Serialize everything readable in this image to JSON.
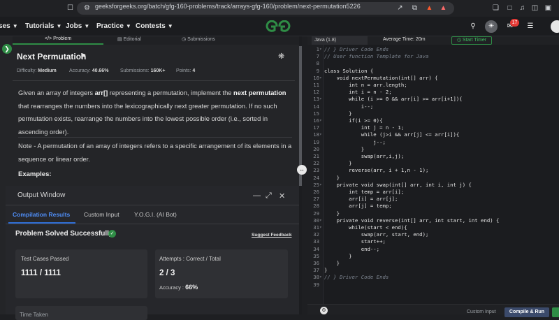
{
  "browser": {
    "url": "geeksforgeeks.org/batch/gfg-160-problems/track/arrays-gfg-160/problem/next-permutation5226",
    "notification_count": "17"
  },
  "nav": {
    "items": [
      {
        "label": "ses"
      },
      {
        "label": "Tutorials"
      },
      {
        "label": "Jobs"
      },
      {
        "label": "Practice"
      },
      {
        "label": "Contests"
      }
    ]
  },
  "left_tabs": {
    "problem": "Problem",
    "editorial": "Editorial",
    "submissions": "Submissions"
  },
  "problem": {
    "title": "Next Permutation",
    "meta": [
      {
        "label": "Difficulty:",
        "value": "Medium"
      },
      {
        "label": "Accuracy:",
        "value": "40.66%"
      },
      {
        "label": "Submissions:",
        "value": "160K+"
      },
      {
        "label": "Points:",
        "value": "4"
      }
    ],
    "para1": {
      "t1": "Given an array of integers ",
      "b1": "arr[]",
      "t2": " representing a permutation, implement the ",
      "b2": "next permutation",
      "t3": " that rearranges the numbers into the lexicographically next greater permutation. If no such permutation exists, rearrange the numbers into the lowest possible order (i.e., sorted in ascending order)."
    },
    "para2": "Note - A permutation of an array of integers refers to a specific arrangement of its elements in a sequence or linear order.",
    "examples_label": "Examples:"
  },
  "output": {
    "title": "Output Window",
    "tabs": [
      "Compilation Results",
      "Custom Input",
      "Y.O.G.I. (AI Bot)"
    ],
    "status": "Problem Solved Successfully",
    "feedback": "Suggest Feedback",
    "test_cases_label": "Test Cases Passed",
    "test_cases_value": "1111 / 1111",
    "attempts_label": "Attempts : Correct / Total",
    "attempts_value": "2 / 3",
    "accuracy_label": "Accuracy :",
    "accuracy_value": "66%",
    "time_taken_label": "Time Taken"
  },
  "editor": {
    "language": "Java (1.8)",
    "avg_time": "Average Time: 20m",
    "start_timer": "Start Timer",
    "custom_input": "Custom Input",
    "compile_run": "Compile & Run",
    "line_numbers": [
      "1",
      "7",
      "8",
      "9",
      "10",
      "11",
      "12",
      "13",
      "14",
      "15",
      "16",
      "17",
      "18",
      "19",
      "20",
      "21",
      "22",
      "23",
      "24",
      "25",
      "26",
      "27",
      "28",
      "29",
      "30",
      "31",
      "32",
      "33",
      "34",
      "35",
      "36",
      "37",
      "38",
      "39"
    ],
    "code_lines": [
      "// } Driver Code Ends",
      "// User function Template for Java",
      "",
      "class Solution {",
      "    void nextPermutation(int[] arr) {",
      "        int n = arr.length;",
      "        int i = n - 2;",
      "        while (i >= 0 && arr[i] >= arr[i+1]){",
      "            i--;",
      "        }",
      "        if(i >= 0){",
      "            int j = n - 1;",
      "            while (j>i && arr[j] <= arr[i]){",
      "                j--;",
      "            }",
      "            swap(arr,i,j);",
      "        }",
      "        reverse(arr, i + 1,n - 1);",
      "    }",
      "    private void swap(int[] arr, int i, int j) {",
      "        int temp = arr[i];",
      "        arr[i] = arr[j];",
      "        arr[j] = temp;",
      "    }",
      "    private void reverse(int[] arr, int start, int end) {",
      "        while(start < end){",
      "            swap(arr, start, end);",
      "            start++;",
      "            end--;",
      "        }",
      "    }",
      "}",
      "// } Driver Code Ends",
      ""
    ]
  }
}
